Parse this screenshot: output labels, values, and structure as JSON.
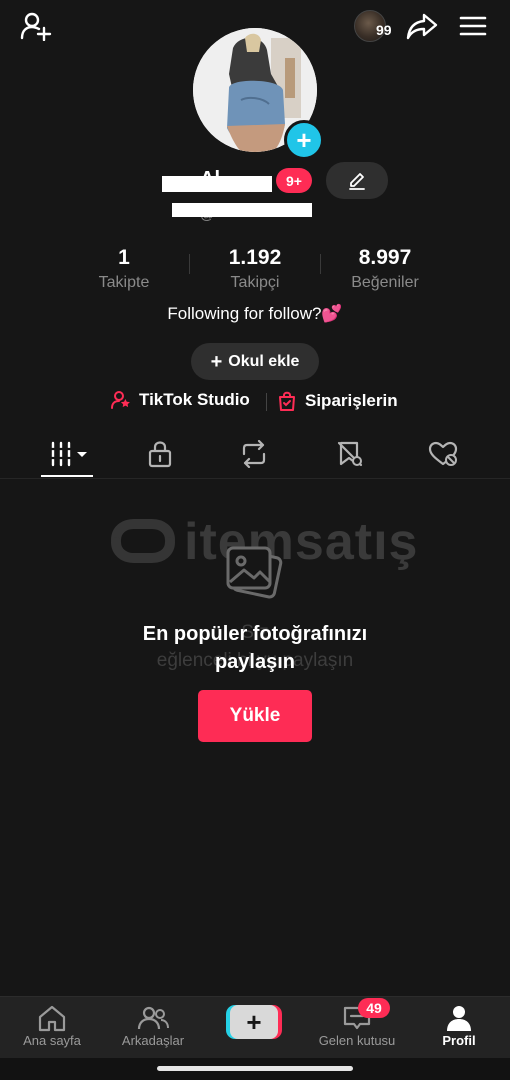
{
  "topbar": {
    "add_friend_icon": "person-plus-icon",
    "story_badge": "99",
    "share_icon": "share-arrow-icon",
    "menu_icon": "hamburger-menu-icon"
  },
  "profile": {
    "name_visible": "Al",
    "handle_visible": "@",
    "notification_badge": "9+",
    "stats": [
      {
        "value": "1",
        "label": "Takipte"
      },
      {
        "value": "1.192",
        "label": "Takipçi"
      },
      {
        "value": "8.997",
        "label": "Beğeniler"
      }
    ],
    "bio": "Following for follow?💕",
    "school_button": "Okul ekle",
    "links": {
      "studio": "TikTok Studio",
      "orders": "Siparişlerin"
    }
  },
  "tabs": [
    {
      "icon": "grid-videos-icon"
    },
    {
      "icon": "lock-icon"
    },
    {
      "icon": "repost-icon"
    },
    {
      "icon": "bookmark-icon"
    },
    {
      "icon": "liked-heart-icon"
    }
  ],
  "watermark": {
    "brand": "itemsatış",
    "line1": "S                                         z",
    "line2": "eğlenceli bi                  yu paylaşın"
  },
  "empty_state": {
    "title_line1": "En popüler fotoğrafınızı",
    "title_line2": "paylaşın",
    "upload_button": "Yükle"
  },
  "bottom_nav": {
    "home": "Ana sayfa",
    "friends": "Arkadaşlar",
    "inbox": "Gelen kutusu",
    "inbox_badge": "49",
    "profile": "Profil"
  },
  "colors": {
    "background": "#161616",
    "accent": "#fe2c55",
    "cyan": "#20c5e8"
  }
}
